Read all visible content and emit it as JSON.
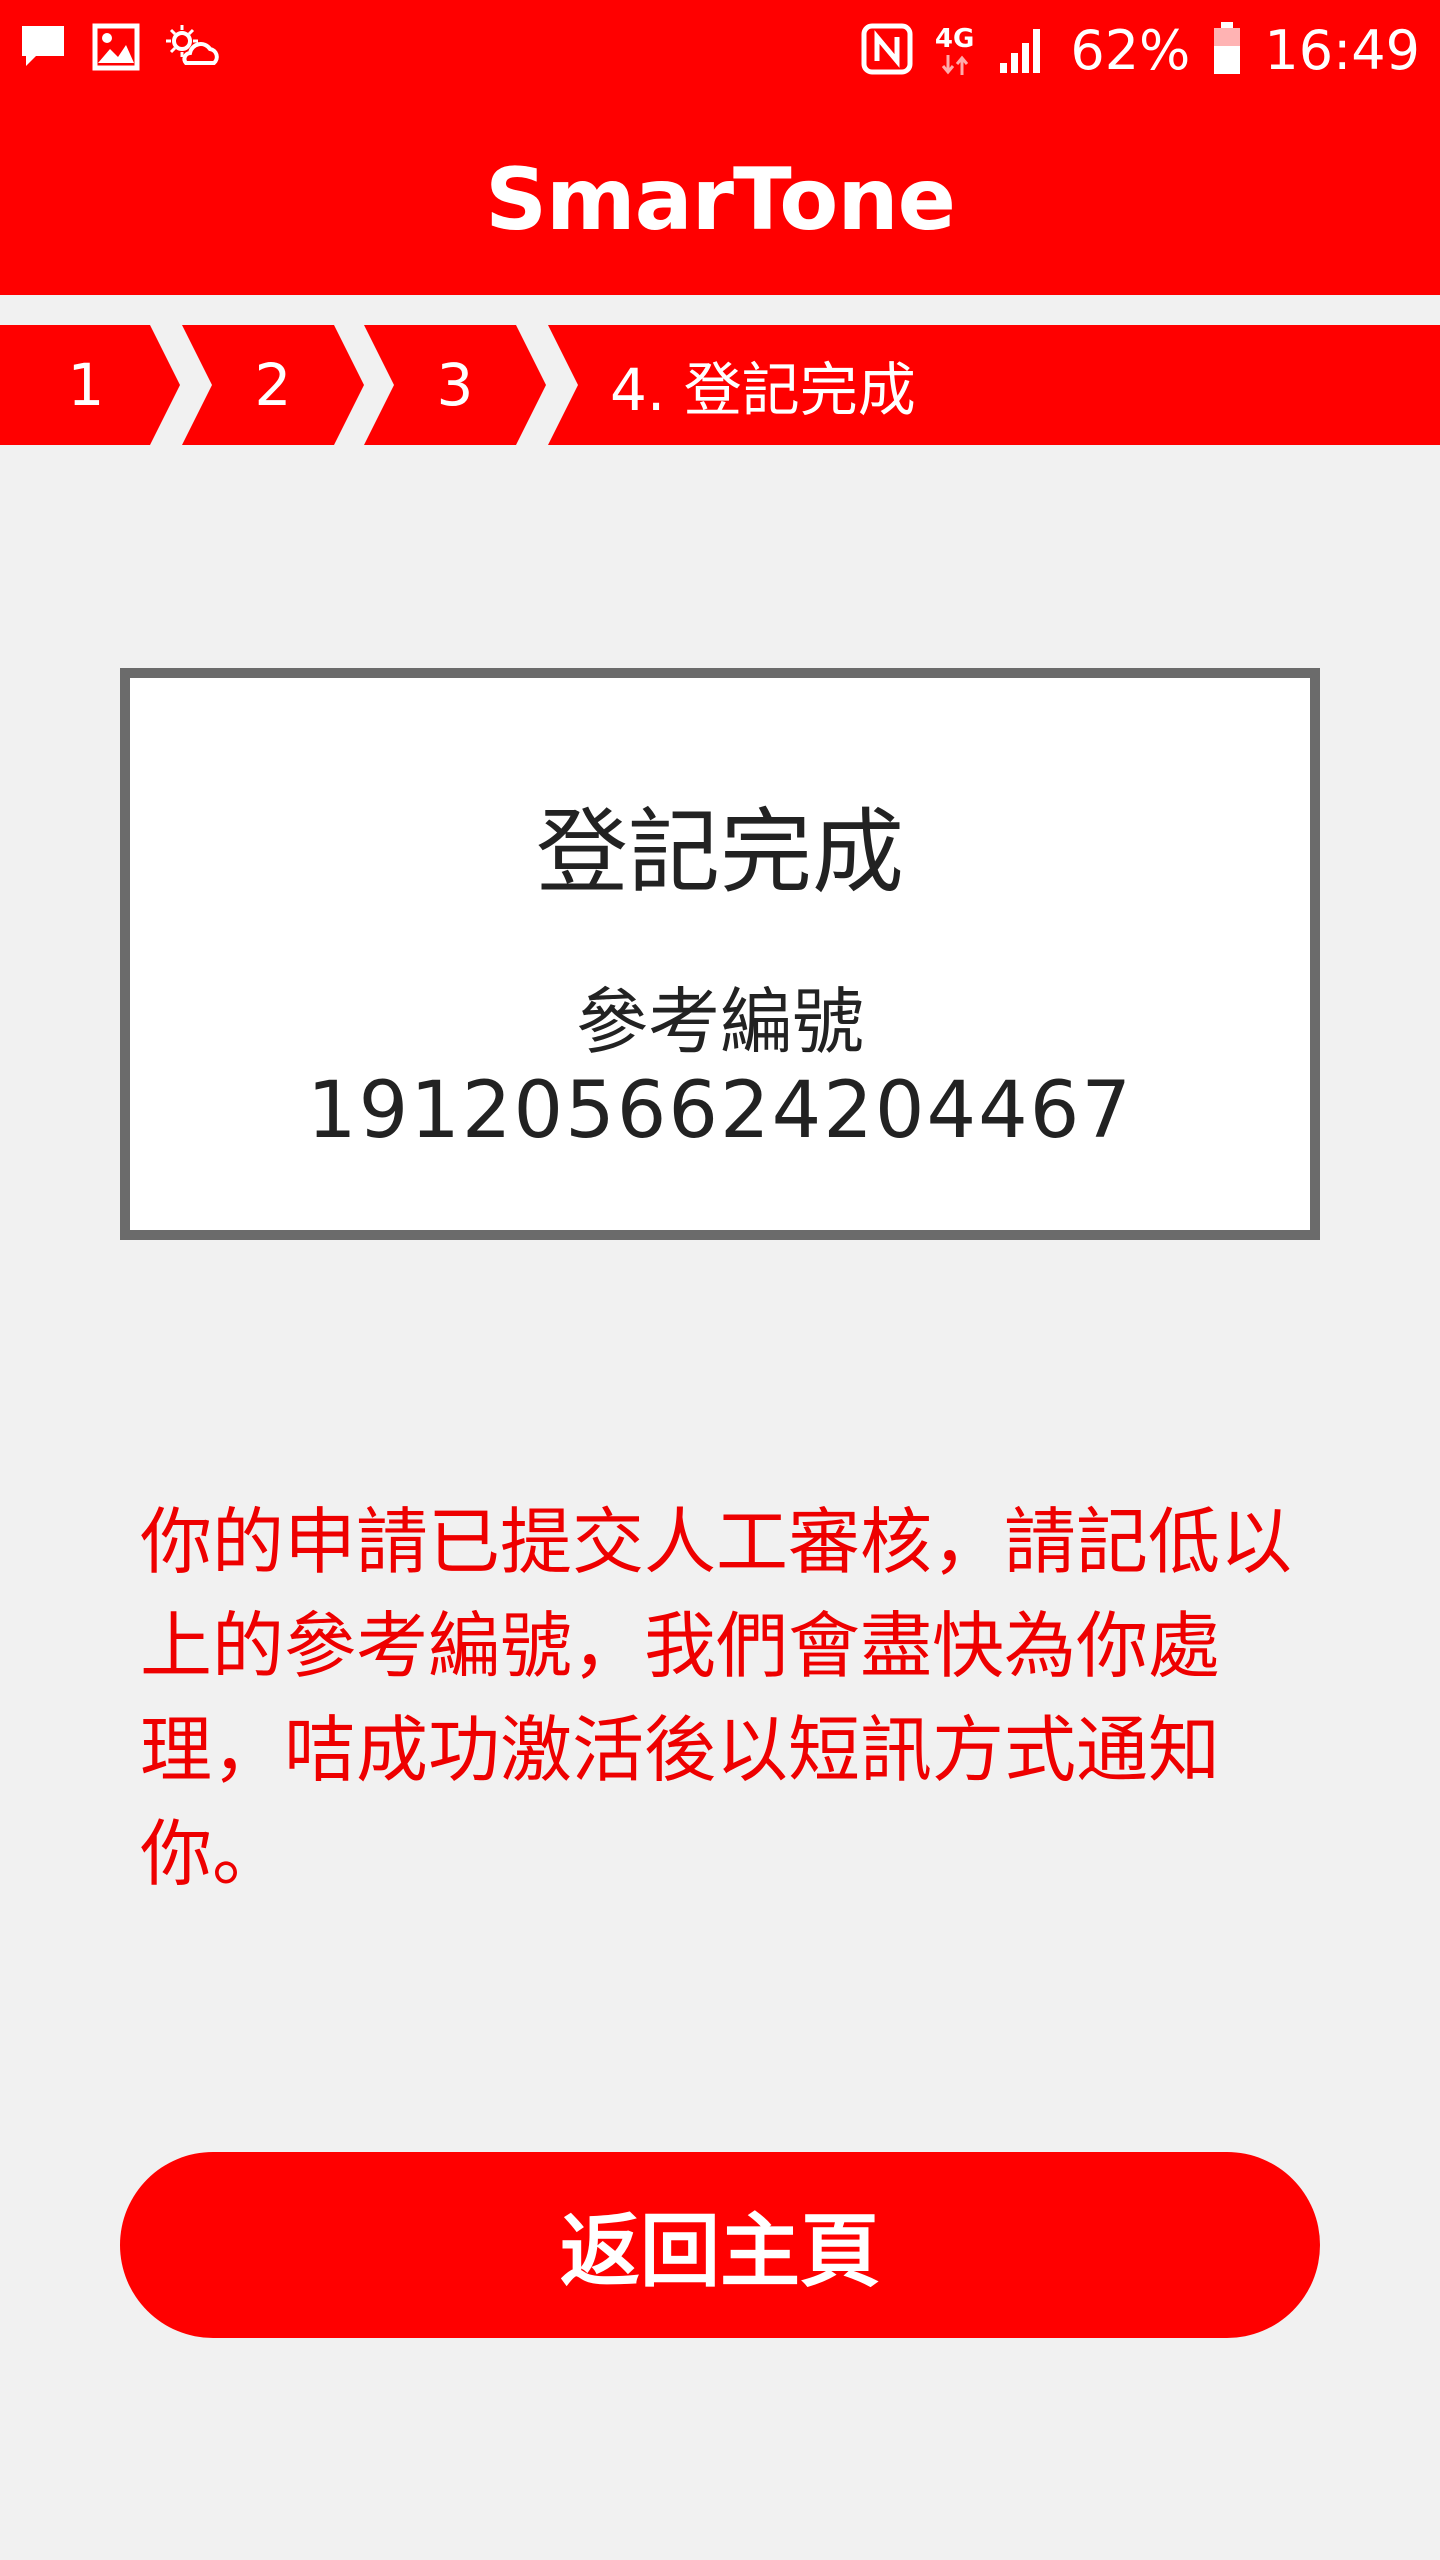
{
  "status_bar": {
    "battery_percent": "62%",
    "time": "16:49",
    "network": "4G",
    "icons": [
      "message-icon",
      "image-icon",
      "weather-icon",
      "nfc-icon",
      "network-4g-icon",
      "signal-icon",
      "battery-icon"
    ]
  },
  "header": {
    "logo_text": "SmarTone",
    "brand_color": "#ff0000"
  },
  "stepper": {
    "steps": [
      {
        "label": "1"
      },
      {
        "label": "2"
      },
      {
        "label": "3"
      },
      {
        "label": "4. 登記完成"
      }
    ],
    "current_step": 4
  },
  "card": {
    "title": "登記完成",
    "reference_label": "參考編號",
    "reference_number": "1912056624204467"
  },
  "message": {
    "text": "你的申請已提交人工審核，請記低以上的參考編號，我們會盡快為你處理，咭成功激活後以短訊方式通知你。",
    "color": "#ee0000"
  },
  "actions": {
    "home_button_label": "返回主頁"
  }
}
